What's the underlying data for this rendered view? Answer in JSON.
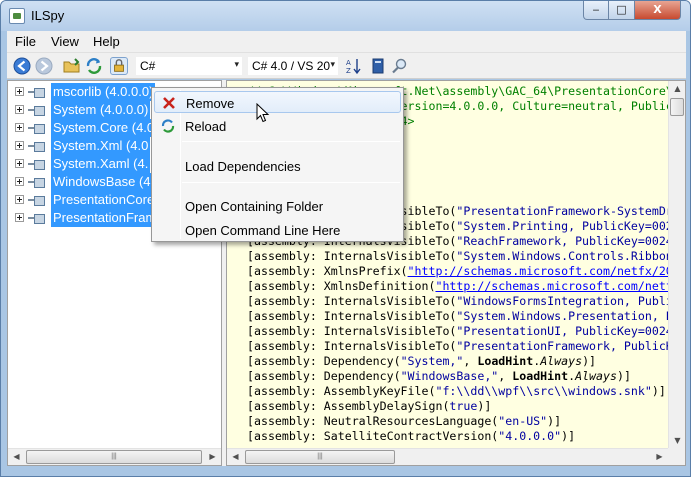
{
  "window": {
    "title": "ILSpy",
    "controls": {
      "minimize": "‒",
      "maximize": "□",
      "close": "X"
    }
  },
  "menu": [
    "File",
    "View",
    "Help"
  ],
  "toolbar": {
    "language": "C#",
    "version": "C# 4.0 / VS 20",
    "dropdown_glyph": "▾"
  },
  "tree": {
    "items": [
      "mscorlib (4.0.0.0)",
      "System (4.0.0.0)",
      "System.Core (4.0",
      "System.Xml (4.0",
      "System.Xaml (4.",
      "WindowsBase (4.",
      "PresentationCore",
      "PresentationFram"
    ]
  },
  "code": {
    "lines": [
      {
        "parts": [
          {
            "t": "// C:\\Windows\\Microsoft.Net\\assembly\\GAC_64\\PresentationCore\\",
            "c": "comment"
          }
        ]
      },
      {
        "parts": [
          {
            "t": "// PresentationCore, Version=4.0.0.0, Culture=neutral, PublicKe",
            "c": "comment"
          }
        ]
      },
      {
        "parts": [
          {
            "t": "// Architecture: <AMD64>",
            "c": "comment"
          }
        ]
      },
      {
        "parts": [
          {
            "t": "",
            "c": ""
          }
        ]
      },
      {
        "parts": [
          {
            "t": "",
            "c": ""
          }
        ]
      },
      {
        "parts": [
          {
            "t": "",
            "c": ""
          }
        ]
      },
      {
        "parts": [
          {
            "t": "",
            "c": ""
          }
        ]
      },
      {
        "parts": [
          {
            "t": "",
            "c": ""
          }
        ]
      },
      {
        "parts": [
          {
            "t": "[assembly: InternalsVisibleTo(",
            "c": ""
          },
          {
            "t": "\"PresentationFramework-SystemDr",
            "c": "str"
          }
        ]
      },
      {
        "parts": [
          {
            "t": "[assembly: InternalsVisibleTo(",
            "c": ""
          },
          {
            "t": "\"System.Printing, PublicKey=002",
            "c": "str"
          }
        ]
      },
      {
        "parts": [
          {
            "t": "[assembly: InternalsVisibleTo(",
            "c": ""
          },
          {
            "t": "\"ReachFramework, PublicKey=0024",
            "c": "str"
          }
        ]
      },
      {
        "parts": [
          {
            "t": "[assembly: InternalsVisibleTo(",
            "c": ""
          },
          {
            "t": "\"System.Windows.Controls.Ribbon",
            "c": "str"
          }
        ]
      },
      {
        "parts": [
          {
            "t": "[assembly: XmlnsPrefix(",
            "c": ""
          },
          {
            "t": "\"http://schemas.microsoft.com/netfx/20",
            "c": "link"
          }
        ]
      },
      {
        "parts": [
          {
            "t": "[assembly: XmlnsDefinition(",
            "c": ""
          },
          {
            "t": "\"http://schemas.microsoft.com/netf",
            "c": "link"
          }
        ]
      },
      {
        "parts": [
          {
            "t": "[assembly: InternalsVisibleTo(",
            "c": ""
          },
          {
            "t": "\"WindowsFormsIntegration, Publi",
            "c": "str"
          }
        ]
      },
      {
        "parts": [
          {
            "t": "[assembly: InternalsVisibleTo(",
            "c": ""
          },
          {
            "t": "\"System.Windows.Presentation, P",
            "c": "str"
          }
        ]
      },
      {
        "parts": [
          {
            "t": "[assembly: InternalsVisibleTo(",
            "c": ""
          },
          {
            "t": "\"PresentationUI, PublicKey=0024",
            "c": "str"
          }
        ]
      },
      {
        "parts": [
          {
            "t": "[assembly: InternalsVisibleTo(",
            "c": ""
          },
          {
            "t": "\"PresentationFramework, PublicK",
            "c": "str"
          }
        ]
      },
      {
        "parts": [
          {
            "t": "[assembly: Dependency(",
            "c": ""
          },
          {
            "t": "\"System,\"",
            "c": "str"
          },
          {
            "t": ", ",
            "c": ""
          },
          {
            "t": "LoadHint",
            "c": "kw"
          },
          {
            "t": ".",
            "c": ""
          },
          {
            "t": "Always",
            "c": "it"
          },
          {
            "t": ")]",
            "c": ""
          }
        ]
      },
      {
        "parts": [
          {
            "t": "[assembly: Dependency(",
            "c": ""
          },
          {
            "t": "\"WindowsBase,\"",
            "c": "str"
          },
          {
            "t": ", ",
            "c": ""
          },
          {
            "t": "LoadHint",
            "c": "kw"
          },
          {
            "t": ".",
            "c": ""
          },
          {
            "t": "Always",
            "c": "it"
          },
          {
            "t": ")]",
            "c": ""
          }
        ]
      },
      {
        "parts": [
          {
            "t": "[assembly: AssemblyKeyFile(",
            "c": ""
          },
          {
            "t": "\"f:\\\\dd\\\\wpf\\\\src\\\\windows.snk\"",
            "c": "str"
          },
          {
            "t": ")]",
            "c": ""
          }
        ]
      },
      {
        "parts": [
          {
            "t": "[assembly: AssemblyDelaySign(",
            "c": ""
          },
          {
            "t": "true",
            "c": "str"
          },
          {
            "t": ")]",
            "c": ""
          }
        ]
      },
      {
        "parts": [
          {
            "t": "[assembly: NeutralResourcesLanguage(",
            "c": ""
          },
          {
            "t": "\"en-US\"",
            "c": "str"
          },
          {
            "t": ")]",
            "c": ""
          }
        ]
      },
      {
        "parts": [
          {
            "t": "[assembly: SatelliteContractVersion(",
            "c": ""
          },
          {
            "t": "\"4.0.0.0\"",
            "c": "str"
          },
          {
            "t": ")]",
            "c": ""
          }
        ]
      }
    ]
  },
  "context_menu": {
    "items": [
      {
        "label": "Remove",
        "icon": "remove-x-icon"
      },
      {
        "label": "Reload",
        "icon": "reload-icon"
      },
      {
        "label": "Load Dependencies",
        "icon": ""
      },
      {
        "label": "Open Containing Folder",
        "icon": ""
      },
      {
        "label": "Open Command Line Here",
        "icon": ""
      }
    ]
  },
  "colors": {
    "selection": "#3399ff",
    "code_background": "#ffffe1",
    "comment": "#008000",
    "string": "#0000a0"
  },
  "scroll_glyphs": {
    "left": "◀",
    "right": "▶",
    "up": "▲",
    "down": "▼",
    "grip": "|||"
  }
}
